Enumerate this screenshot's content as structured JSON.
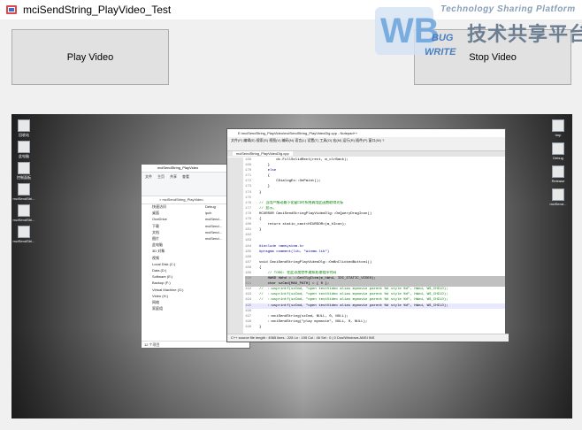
{
  "window": {
    "title": "mciSendString_PlayVideo_Test"
  },
  "buttons": {
    "play": "Play Video",
    "stop": "Stop Video"
  },
  "watermark": {
    "tagline": "Technology Sharing Platform",
    "chinese": "技术共享平台",
    "logo_letters": "WB",
    "logo_bug": "BUG",
    "logo_write": "WRITE"
  },
  "video": {
    "desktop_icons_left": [
      "回收站",
      "此电脑",
      "控制面板",
      "mciSendStri...",
      "mciSendStri...",
      "mciSendStri..."
    ],
    "desktop_icons_right": [
      "tmp",
      "Debug",
      "Release",
      "mciSend..."
    ],
    "explorer": {
      "title": "mciSendString_PlayVideo",
      "tabs": [
        "文件",
        "主页",
        "共享",
        "查看"
      ],
      "address": "> mciSendString_PlayVideo",
      "nav_items": [
        "快速访问",
        "桌面",
        "OneDrive",
        "下载",
        "文档",
        "图片",
        "此电脑",
        "3D 对象",
        "视频",
        "Local Disk (C:)",
        "Data (D:)",
        "Software (E:)",
        "Backup (F:)",
        "Virtual Machine (G:)",
        "Video (H:)",
        "网络",
        "家庭组"
      ],
      "files": [
        "Debug",
        "ipch",
        "mciSend...",
        "mciSend...",
        "mciSend...",
        "mciSend..."
      ],
      "status": "12 个项目"
    },
    "editor": {
      "title": "E:\\mciSendString_PlayVideo\\mciSendString_PlayVideoDlg.cpp - Notepad++",
      "menu": "文件(F)  编辑(E)  搜索(S)  视图(V)  编码(N)  语言(L)  设置(T)  工具(O)  宏(M)  运行(R)  插件(P)  窗口(W)  ?",
      "tab": "mciSendString_PlayVideoDlg.cpp",
      "lines": [
        {
          "n": "168",
          "t": "        dc.FillSolidRect(rect, m_clrBack);",
          "c": ""
        },
        {
          "n": "169",
          "t": "    }",
          "c": ""
        },
        {
          "n": "170",
          "t": "    else",
          "c": "kw"
        },
        {
          "n": "171",
          "t": "    {",
          "c": ""
        },
        {
          "n": "172",
          "t": "        CDialogEx::OnPaint();",
          "c": ""
        },
        {
          "n": "173",
          "t": "    }",
          "c": ""
        },
        {
          "n": "174",
          "t": "}",
          "c": ""
        },
        {
          "n": "175",
          "t": "",
          "c": ""
        },
        {
          "n": "176",
          "t": "// 当用户拖动最小化窗口时系统调用此函数取得光标",
          "c": "cmt"
        },
        {
          "n": "177",
          "t": "// 显示。",
          "c": "cmt"
        },
        {
          "n": "178",
          "t": "HCURSOR CmciSendStringPlayVideoDlg::OnQueryDragIcon()",
          "c": ""
        },
        {
          "n": "179",
          "t": "{",
          "c": ""
        },
        {
          "n": "180",
          "t": "    return static_cast<HCURSOR>(m_hIcon);",
          "c": ""
        },
        {
          "n": "181",
          "t": "}",
          "c": ""
        },
        {
          "n": "182",
          "t": "",
          "c": ""
        },
        {
          "n": "183",
          "t": "",
          "c": ""
        },
        {
          "n": "184",
          "t": "#include <mmsystem.h>",
          "c": "kw"
        },
        {
          "n": "185",
          "t": "#pragma comment(lib, \"winmm.lib\")",
          "c": "kw"
        },
        {
          "n": "186",
          "t": "",
          "c": ""
        },
        {
          "n": "187",
          "t": "void CmciSendStringPlayVideoDlg::OnBnClickedButton1()",
          "c": ""
        },
        {
          "n": "188",
          "t": "{",
          "c": ""
        },
        {
          "n": "189",
          "t": "    // TODO: 在此添加控件通知处理程序代码",
          "c": "cmt"
        },
        {
          "n": "190",
          "t": "    HWND hWnd = ::GetDlgItem(m_hWnd, IDC_STATIC_VIDEO);",
          "c": "sel"
        },
        {
          "n": "191",
          "t": "    char szCmd[MAX_PATH] = { 0 };",
          "c": "sel"
        },
        {
          "n": "192",
          "t": "//  ::wsprintf(szCmd, \"open testVideo alias mymovie parent %d style %d\", hWnd, WS_CHILD);",
          "c": "cmt"
        },
        {
          "n": "193",
          "t": "//  ::wsprintf(szCmd, \"open testVideo alias mymovie parent %d style %d\", hWnd, WS_CHILD);",
          "c": "cmt"
        },
        {
          "n": "194",
          "t": "//  ::wsprintf(szCmd, \"open testVideo alias mymovie parent %d style %d\", hWnd, WS_CHILD);",
          "c": "cmt"
        },
        {
          "n": "195",
          "t": "    ::wsprintf(szCmd, \"open testVideo alias mymovie parent %d style %d\", hWnd, WS_CHILD);",
          "c": "hl"
        },
        {
          "n": "196",
          "t": "",
          "c": ""
        },
        {
          "n": "197",
          "t": "    ::mciSendString(szCmd, NULL, 0, NULL);",
          "c": ""
        },
        {
          "n": "198",
          "t": "    ::mciSendString(\"play mymovie\", NULL, 0, NULL);",
          "c": ""
        },
        {
          "n": "199",
          "t": "}",
          "c": ""
        }
      ],
      "status": "C++ source file   length : 4965   lines : 228     Ln : 195   Col : 46   Sel : 0 | 0     Dos\\Windows   ANSI   INS"
    }
  },
  "colors": {
    "window_bg": "#f0f0f0",
    "button_bg": "#e1e1e1",
    "button_border": "#adadad",
    "watermark_blue": "#4a90d9"
  }
}
